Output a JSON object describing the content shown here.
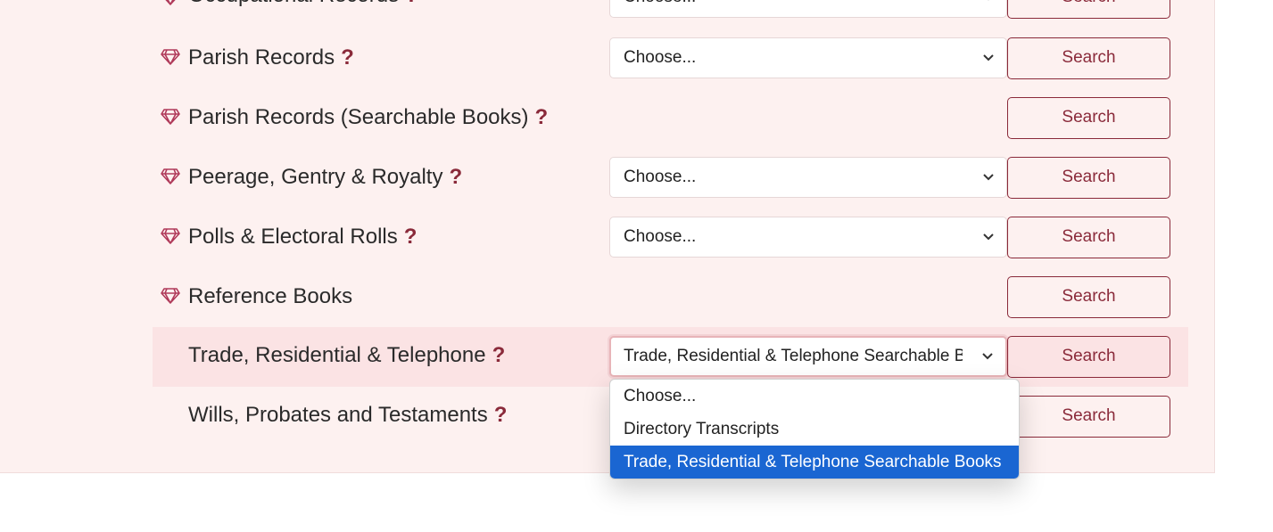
{
  "rows": [
    {
      "label": "Occupational Records",
      "select": "Choose...",
      "button": "Search"
    },
    {
      "label": "Parish Records",
      "select": "Choose...",
      "button": "Search"
    },
    {
      "label": "Parish Records (Searchable Books)",
      "button": "Search"
    },
    {
      "label": "Peerage, Gentry & Royalty",
      "select": "Choose...",
      "button": "Search"
    },
    {
      "label": "Polls & Electoral Rolls",
      "select": "Choose...",
      "button": "Search"
    },
    {
      "label": "Reference Books",
      "button": "Search"
    },
    {
      "label": "Trade, Residential & Telephone",
      "select": "Trade, Residential & Telephone Searchable Books",
      "button": "Search"
    },
    {
      "label": "Wills, Probates and Testaments",
      "button": "Search"
    }
  ],
  "help_mark": "?",
  "dropdown": {
    "options": [
      "Choose...",
      "Directory Transcripts",
      "Trade, Residential & Telephone Searchable Books"
    ],
    "selected_index": 2
  },
  "colors": {
    "panel_bg": "#fdf1f0",
    "accent": "#8a2a3a",
    "row_highlight": "#fbe3e4",
    "option_selected": "#1a66d2"
  },
  "icons": {
    "premium": "gem-icon",
    "dropdown": "chevron-down-icon"
  }
}
